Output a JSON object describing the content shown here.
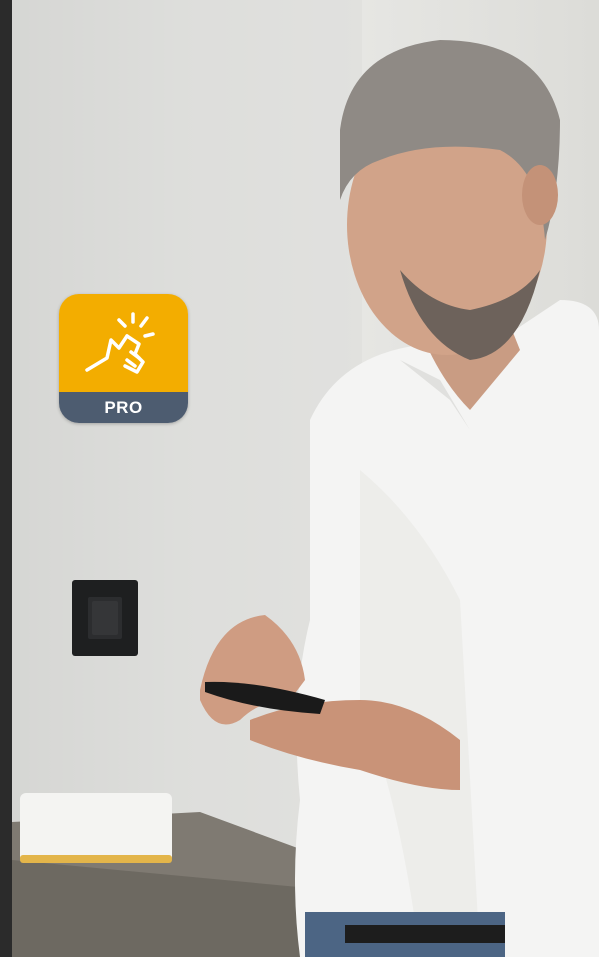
{
  "app_icon": {
    "badge": "PRO",
    "icon": "hand-pointing-gesture-icon",
    "colors": {
      "top": "#f3ad00",
      "bottom": "#4d5c70"
    }
  }
}
